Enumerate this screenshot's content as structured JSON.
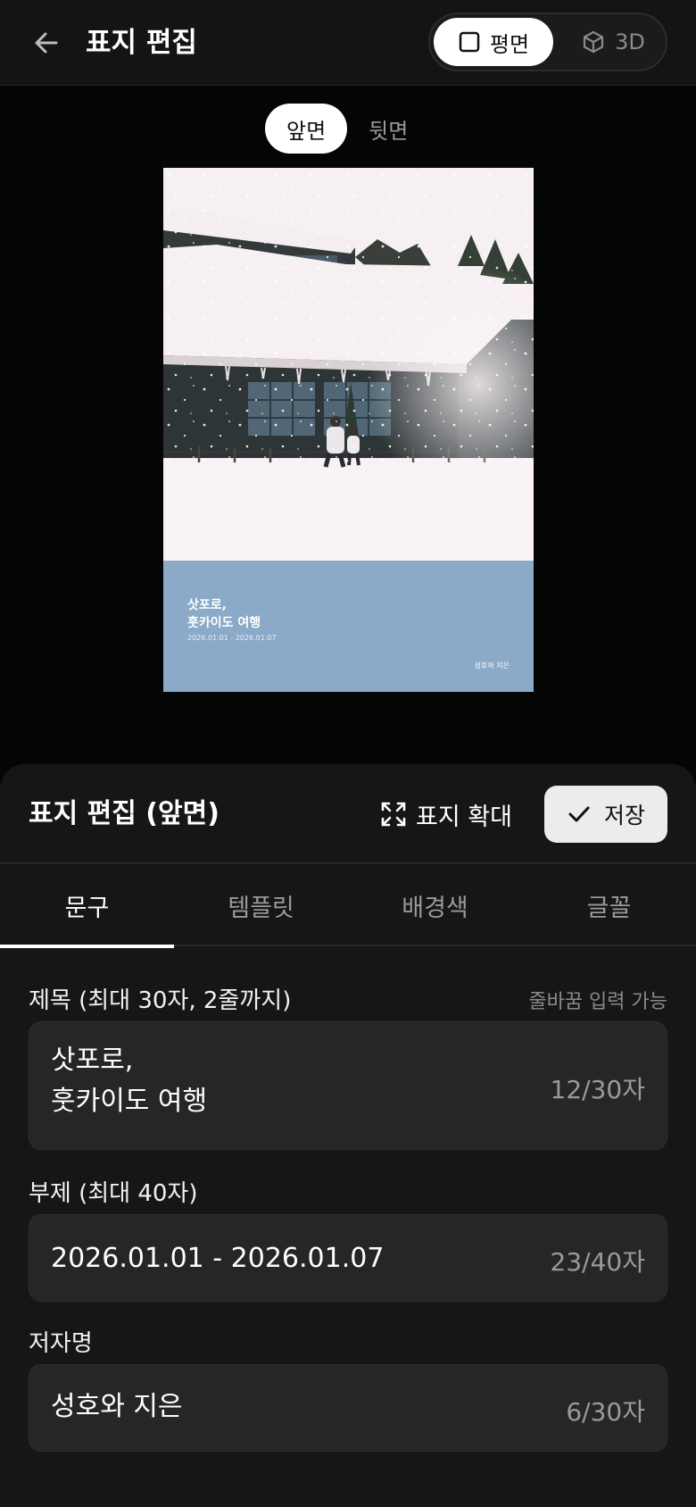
{
  "header": {
    "title": "표지 편집",
    "view_modes": [
      "평면",
      "3D"
    ],
    "active_view": "평면"
  },
  "preview": {
    "side_tabs": [
      "앞면",
      "뒷면"
    ],
    "active_side": "앞면",
    "cover": {
      "title": "삿포로,\n훗카이도 여행",
      "subtitle": "2026.01.01 - 2026.01.07",
      "author": "성호와 지은",
      "band_color": "#8aaac7"
    }
  },
  "sheet": {
    "title": "표지 편집 (앞면)",
    "zoom_label": "표지 확대",
    "save_label": "저장",
    "tabs": [
      "문구",
      "템플릿",
      "배경색",
      "글꼴"
    ],
    "active_tab": "문구",
    "fields": {
      "title": {
        "label": "제목 (최대 30자, 2줄까지)",
        "hint": "줄바꿈 입력 가능",
        "value": "삿포로,\n훗카이도 여행",
        "count": "12/30자"
      },
      "subtitle": {
        "label": "부제 (최대 40자)",
        "value": "2026.01.01 - 2026.01.07",
        "count": "23/40자"
      },
      "author": {
        "label": "저자명",
        "value": "성호와 지은",
        "count": "6/30자"
      }
    }
  },
  "icons": {
    "back": "arrow-left-icon",
    "flat": "square-icon",
    "three_d": "cube-icon",
    "zoom": "expand-icon",
    "save": "check-icon"
  }
}
